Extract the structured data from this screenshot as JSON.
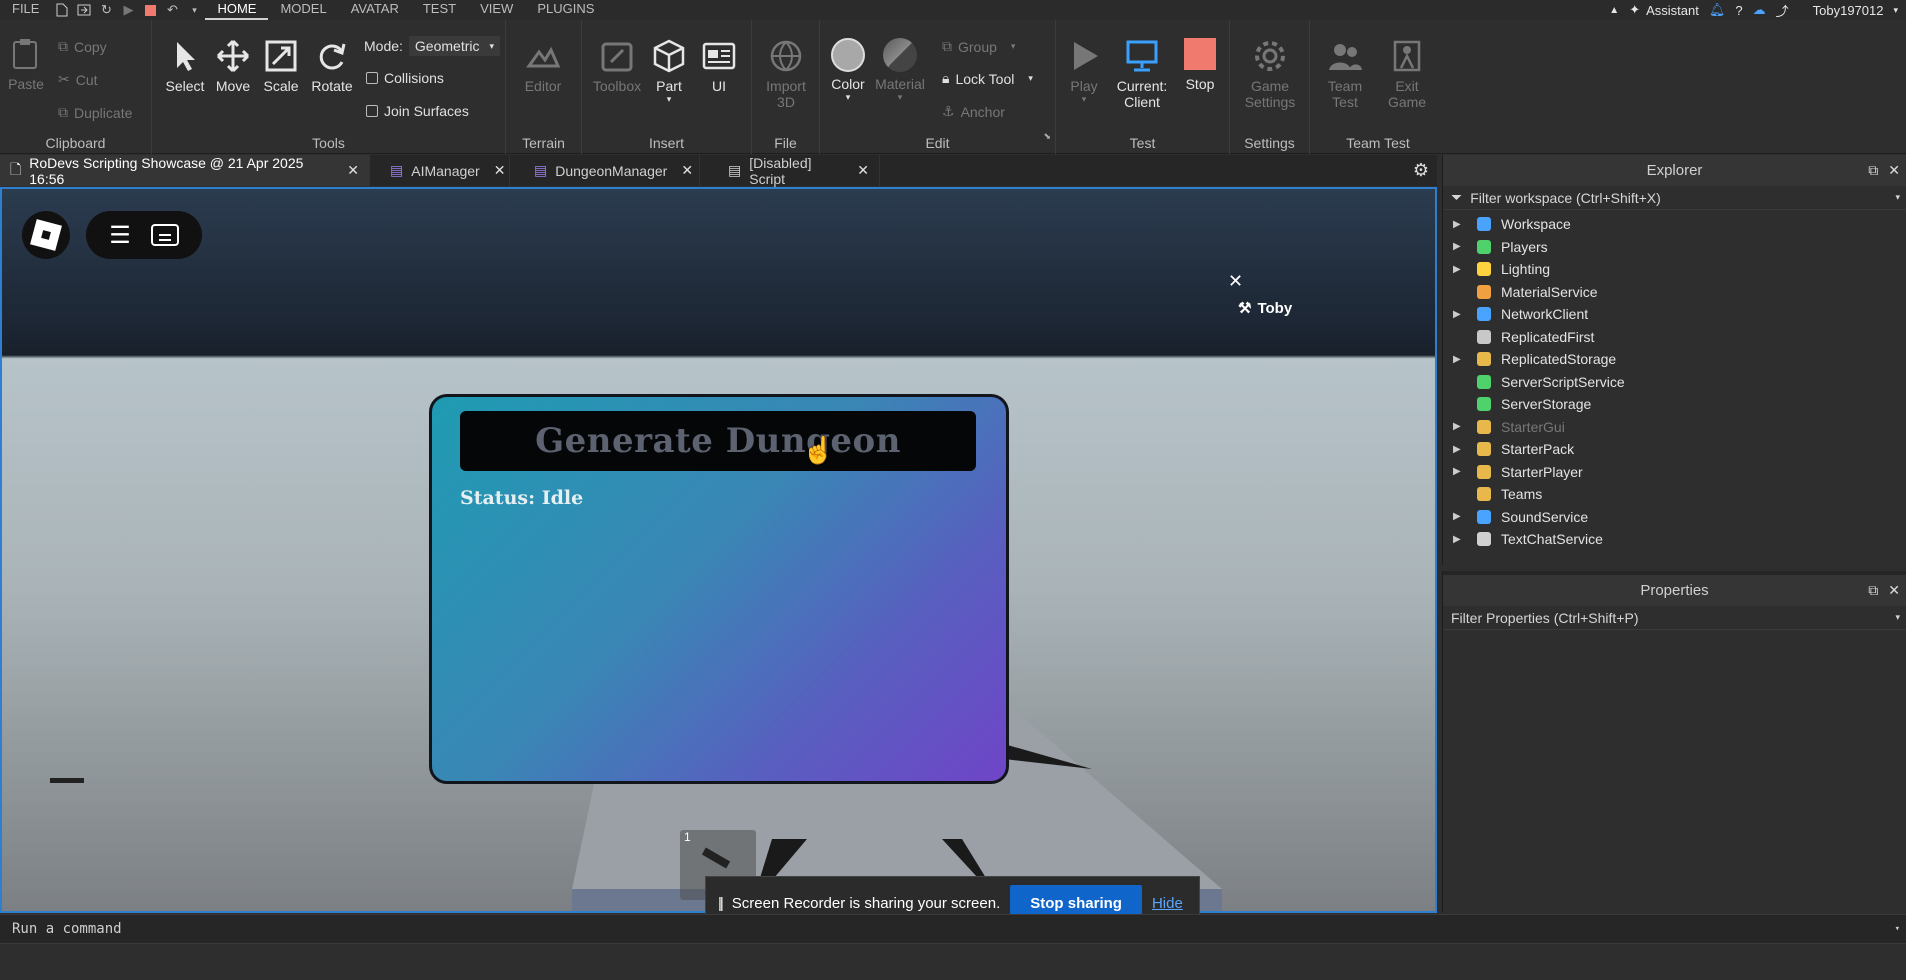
{
  "menu": {
    "file": "FILE",
    "tabs": [
      "HOME",
      "MODEL",
      "AVATAR",
      "TEST",
      "VIEW",
      "PLUGINS"
    ],
    "active_tab": "HOME",
    "assistant": "Assistant",
    "username": "Toby197012"
  },
  "ribbon": {
    "clipboard": {
      "paste": "Paste",
      "copy": "Copy",
      "cut": "Cut",
      "duplicate": "Duplicate",
      "label": "Clipboard"
    },
    "tools": {
      "select": "Select",
      "move": "Move",
      "scale": "Scale",
      "rotate": "Rotate",
      "mode_label": "Mode:",
      "mode_value": "Geometric",
      "collisions": "Collisions",
      "join_surfaces": "Join Surfaces",
      "label": "Tools"
    },
    "terrain": {
      "editor": "Editor",
      "label": "Terrain"
    },
    "insert": {
      "toolbox": "Toolbox",
      "part": "Part",
      "ui": "UI",
      "label": "Insert"
    },
    "file": {
      "import": "Import",
      "import2": "3D",
      "label": "File"
    },
    "edit": {
      "color": "Color",
      "material": "Material",
      "group": "Group",
      "lock_tool": "Lock Tool",
      "anchor": "Anchor",
      "label": "Edit"
    },
    "test": {
      "play": "Play",
      "current": "Current:",
      "client": "Client",
      "stop": "Stop",
      "label": "Test"
    },
    "settings": {
      "game": "Game",
      "settings": "Settings",
      "label": "Settings"
    },
    "team_test": {
      "team": "Team",
      "test": "Test",
      "exit": "Exit",
      "game": "Game",
      "label": "Team Test"
    }
  },
  "doc_tabs": [
    {
      "label": "RoDevs Scripting Showcase @ 21 Apr 2025 16:56",
      "icon": "place-icon"
    },
    {
      "label": "AIManager",
      "icon": "module-script-icon"
    },
    {
      "label": "DungeonManager",
      "icon": "module-script-icon"
    },
    {
      "label": "[Disabled] Script",
      "icon": "script-icon"
    }
  ],
  "viewport": {
    "player_name": "Toby",
    "gui": {
      "button": "Generate Dungeon",
      "status": "Status: Idle"
    },
    "hotbar_slot": "1"
  },
  "share_banner": {
    "text": "Screen Recorder is sharing your screen.",
    "stop": "Stop sharing",
    "hide": "Hide"
  },
  "command_bar": {
    "placeholder": "Run a command"
  },
  "explorer": {
    "title": "Explorer",
    "filter": "Filter workspace (Ctrl+Shift+X)",
    "items": [
      {
        "label": "Workspace",
        "expandable": true,
        "icon": "workspace-icon",
        "color": "#4aa3ff"
      },
      {
        "label": "Players",
        "expandable": true,
        "icon": "players-icon",
        "color": "#4fd16b"
      },
      {
        "label": "Lighting",
        "expandable": true,
        "icon": "lightbulb-icon",
        "color": "#ffd33d"
      },
      {
        "label": "MaterialService",
        "expandable": false,
        "icon": "material-service-icon",
        "color": "#f0a040"
      },
      {
        "label": "NetworkClient",
        "expandable": true,
        "icon": "network-icon",
        "color": "#4aa3ff"
      },
      {
        "label": "ReplicatedFirst",
        "expandable": false,
        "icon": "replicated-first-icon",
        "color": "#c8c8c8"
      },
      {
        "label": "ReplicatedStorage",
        "expandable": true,
        "icon": "replicated-storage-icon",
        "color": "#e8b84a"
      },
      {
        "label": "ServerScriptService",
        "expandable": false,
        "icon": "server-script-service-icon",
        "color": "#4fd16b"
      },
      {
        "label": "ServerStorage",
        "expandable": false,
        "icon": "server-storage-icon",
        "color": "#4fd16b"
      },
      {
        "label": "StarterGui",
        "expandable": true,
        "icon": "starter-gui-icon",
        "color": "#e8b84a",
        "dim": true
      },
      {
        "label": "StarterPack",
        "expandable": true,
        "icon": "starter-pack-icon",
        "color": "#e8b84a"
      },
      {
        "label": "StarterPlayer",
        "expandable": true,
        "icon": "starter-player-icon",
        "color": "#e8b84a"
      },
      {
        "label": "Teams",
        "expandable": false,
        "icon": "teams-icon",
        "color": "#e8b84a"
      },
      {
        "label": "SoundService",
        "expandable": true,
        "icon": "sound-service-icon",
        "color": "#4aa3ff"
      },
      {
        "label": "TextChatService",
        "expandable": true,
        "icon": "text-chat-icon",
        "color": "#d0d0d0"
      }
    ]
  },
  "properties": {
    "title": "Properties",
    "filter": "Filter Properties (Ctrl+Shift+P)"
  }
}
